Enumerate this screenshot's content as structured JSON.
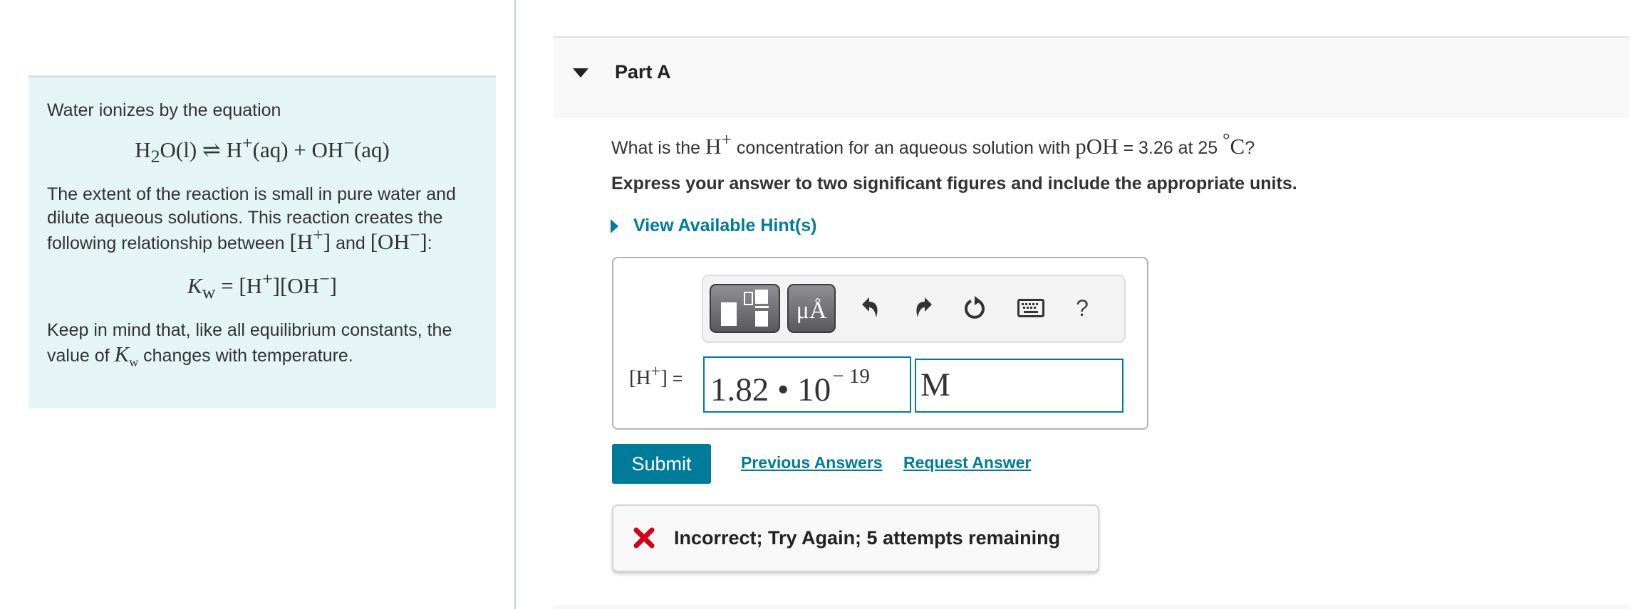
{
  "info_panel": {
    "intro": "Water ionizes by the equation",
    "equation": {
      "lhs": "H",
      "lhs_sub": "2",
      "lhs_rest": "O(l)",
      "arrow": "⇌",
      "h": "H",
      "h_sup": "+",
      "aq1": "(aq)",
      "plus": "+",
      "oh": "OH",
      "oh_sup": "−",
      "aq2": "(aq)"
    },
    "para1_a": "The extent of the reaction is small in pure water and dilute aqueous solutions. This reaction creates the following relationship between ",
    "para1_h": "[H",
    "para1_h_sup": "+",
    "para1_h_close": "]",
    "para1_and": " and ",
    "para1_oh": "[OH",
    "para1_oh_sup": "−",
    "para1_oh_close": "]",
    "para1_colon": ":",
    "kw_equation": {
      "k": "K",
      "k_sub": "w",
      "eq": " = ",
      "h": "[H",
      "h_sup": "+",
      "h_close": "]",
      "oh": "[OH",
      "oh_sup": "−",
      "oh_close": "]"
    },
    "para2_a": "Keep in mind that, like all equilibrium constants, the value of ",
    "para2_k": "K",
    "para2_k_sub": "w",
    "para2_b": " changes with temperature."
  },
  "part": {
    "title": "Part A",
    "question_a": "What is the ",
    "question_h": "H",
    "question_h_sup": "+",
    "question_b": " concentration for an aqueous solution with ",
    "question_poh": "pOH",
    "question_c": " = 3.26 at 25 ",
    "question_deg": "°",
    "question_unit": "C",
    "question_end": "?",
    "instruction": "Express your answer to two significant figures and include the appropriate units.",
    "hint_label": "View Available Hint(s)"
  },
  "toolbar": {
    "templates_icon": "templates-icon",
    "units_label": "μÅ",
    "undo_icon": "undo-icon",
    "redo_icon": "redo-icon",
    "reset_icon": "reset-icon",
    "keyboard_icon": "keyboard-icon",
    "help_label": "?"
  },
  "answer": {
    "label_h": "[H",
    "label_sup": "+",
    "label_close": "]",
    "label_eq": " =",
    "value_mantissa": "1.82",
    "value_dot": " • ",
    "value_base": "10",
    "value_exponent": "− 19",
    "unit": "M"
  },
  "actions": {
    "submit_label": "Submit",
    "previous_answers_label": "Previous Answers",
    "request_answer_label": "Request Answer"
  },
  "feedback": {
    "status": "incorrect",
    "message": "Incorrect; Try Again; 5 attempts remaining",
    "color": "#d0021b"
  },
  "colors": {
    "accent": "#007b9a",
    "info_bg": "#e5f4f5",
    "error": "#d0021b"
  }
}
